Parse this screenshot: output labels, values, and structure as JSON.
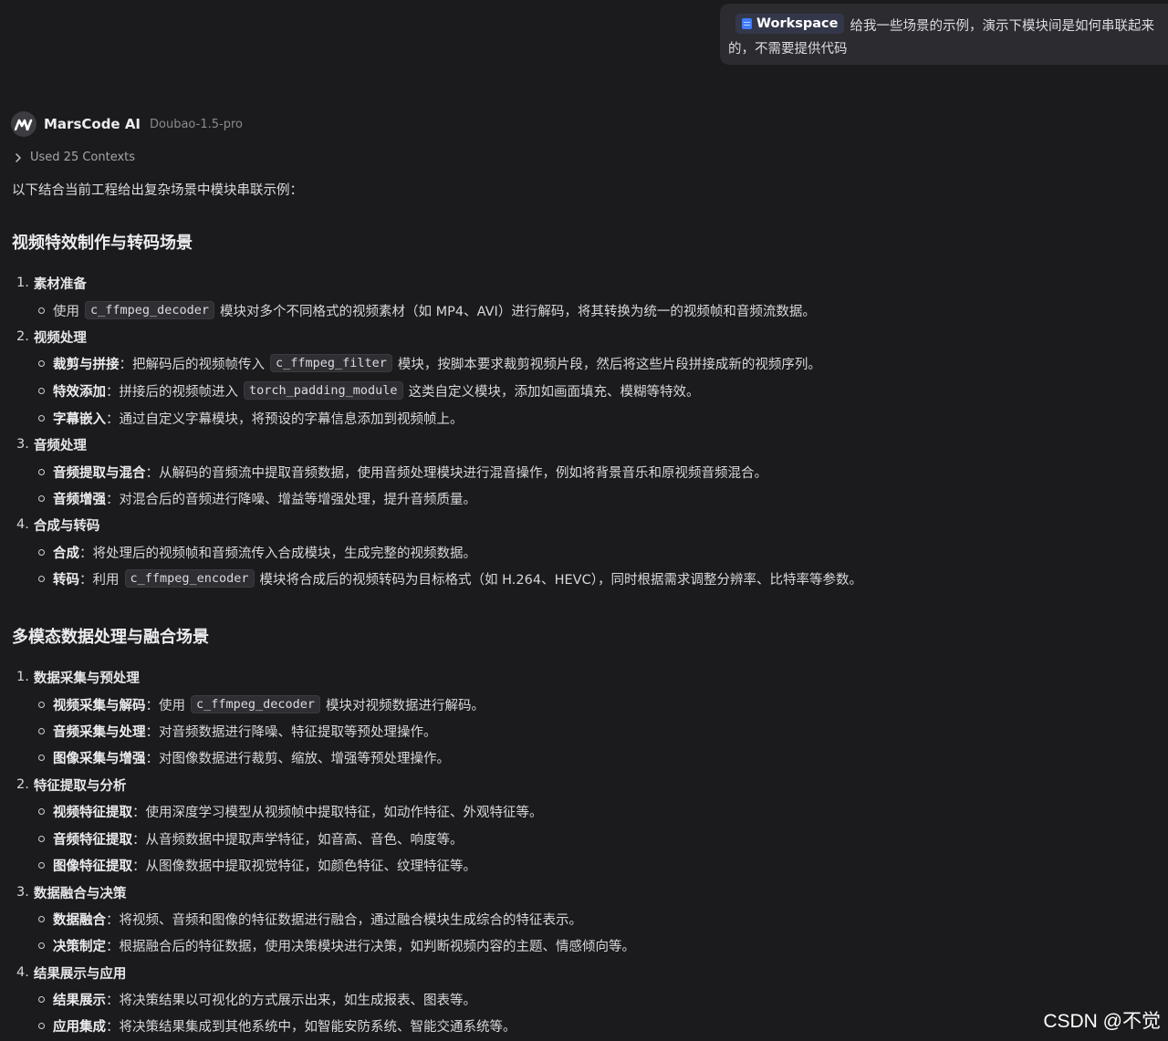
{
  "user_message": {
    "chip_label": "Workspace",
    "text": "给我一些场景的示例，演示下模块间是如何串联起来的，不需要提供代码"
  },
  "ai": {
    "name": "MarsCode AI",
    "model": "Doubao-1.5-pro",
    "contexts": "Used 25 Contexts",
    "intro": "以下结合当前工程给出复杂场景中模块串联示例："
  },
  "section1": {
    "title": "视频特效制作与转码场景",
    "steps": [
      {
        "num": "1.",
        "title": "素材准备"
      },
      {
        "num": "2.",
        "title": "视频处理"
      },
      {
        "num": "3.",
        "title": "音频处理"
      },
      {
        "num": "4.",
        "title": "合成与转码"
      }
    ],
    "b1": {
      "pre": "使用",
      "code": "c_ffmpeg_decoder",
      "post": "模块对多个不同格式的视频素材（如 MP4、AVI）进行解码，将其转换为统一的视频帧和音频流数据。"
    },
    "b2": {
      "label": "裁剪与拼接",
      "pre": "：把解码后的视频帧传入",
      "code": "c_ffmpeg_filter",
      "post": "模块，按脚本要求裁剪视频片段，然后将这些片段拼接成新的视频序列。"
    },
    "b3": {
      "label": "特效添加",
      "pre": "：拼接后的视频帧进入",
      "code": "torch_padding_module",
      "post": "这类自定义模块，添加如画面填充、模糊等特效。"
    },
    "b4": {
      "label": "字幕嵌入",
      "text": "：通过自定义字幕模块，将预设的字幕信息添加到视频帧上。"
    },
    "b5": {
      "label": "音频提取与混合",
      "text": "：从解码的音频流中提取音频数据，使用音频处理模块进行混音操作，例如将背景音乐和原视频音频混合。"
    },
    "b6": {
      "label": "音频增强",
      "text": "：对混合后的音频进行降噪、增益等增强处理，提升音频质量。"
    },
    "b7": {
      "label": "合成",
      "text": "：将处理后的视频帧和音频流传入合成模块，生成完整的视频数据。"
    },
    "b8": {
      "label": "转码",
      "pre": "：利用",
      "code": "c_ffmpeg_encoder",
      "post": "模块将合成后的视频转码为目标格式（如 H.264、HEVC），同时根据需求调整分辨率、比特率等参数。"
    }
  },
  "section2": {
    "title": "多模态数据处理与融合场景",
    "steps": [
      {
        "num": "1.",
        "title": "数据采集与预处理"
      },
      {
        "num": "2.",
        "title": "特征提取与分析"
      },
      {
        "num": "3.",
        "title": "数据融合与决策"
      },
      {
        "num": "4.",
        "title": "结果展示与应用"
      }
    ],
    "b1": {
      "label": "视频采集与解码",
      "pre": "：使用",
      "code": "c_ffmpeg_decoder",
      "post": "模块对视频数据进行解码。"
    },
    "b2": {
      "label": "音频采集与处理",
      "text": "：对音频数据进行降噪、特征提取等预处理操作。"
    },
    "b3": {
      "label": "图像采集与增强",
      "text": "：对图像数据进行裁剪、缩放、增强等预处理操作。"
    },
    "b4": {
      "label": "视频特征提取",
      "text": "：使用深度学习模型从视频帧中提取特征，如动作特征、外观特征等。"
    },
    "b5": {
      "label": "音频特征提取",
      "text": "：从音频数据中提取声学特征，如音高、音色、响度等。"
    },
    "b6": {
      "label": "图像特征提取",
      "text": "：从图像数据中提取视觉特征，如颜色特征、纹理特征等。"
    },
    "b7": {
      "label": "数据融合",
      "text": "：将视频、音频和图像的特征数据进行融合，通过融合模块生成综合的特征表示。"
    },
    "b8": {
      "label": "决策制定",
      "text": "：根据融合后的特征数据，使用决策模块进行决策，如判断视频内容的主题、情感倾向等。"
    },
    "b9": {
      "label": "结果展示",
      "text": "：将决策结果以可视化的方式展示出来，如生成报表、图表等。"
    },
    "b10": {
      "label": "应用集成",
      "text": "：将决策结果集成到其他系统中，如智能安防系统、智能交通系统等。"
    }
  },
  "watermark": "CSDN @不觉"
}
